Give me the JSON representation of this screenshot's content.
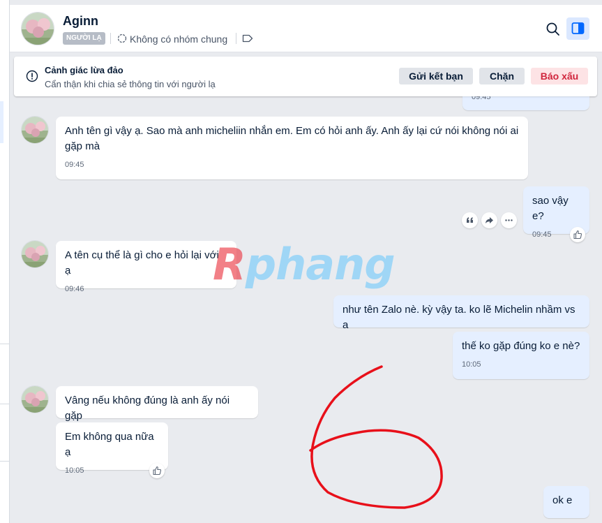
{
  "header": {
    "contact_name": "Aginn",
    "stranger_badge": "NGƯỜI LẠ",
    "common_groups": "Không có nhóm chung"
  },
  "alert": {
    "title": "Cảnh giác lừa đảo",
    "subtitle": "Cẩn thận khi chia sẻ thông tin với người lạ",
    "add_friend": "Gửi kết bạn",
    "block": "Chặn",
    "report": "Báo xấu"
  },
  "messages": [
    {
      "from": "them",
      "text": "Anh tên gì vậy ạ. Sao mà anh micheliin nhắn em. Em có hỏi anh ấy. Anh ấy lại cứ nói không nói ai gặp mà",
      "time": "09:45"
    },
    {
      "from": "me",
      "text": "sao vậy e?",
      "time": "09:45"
    },
    {
      "from": "them",
      "text": "A tên cụ thể là gì cho e hỏi lại với ạ",
      "time": "09:46"
    },
    {
      "from": "me",
      "text": "như tên Zalo nè. kỳ vậy ta. ko lẽ Michelin nhầm vs a",
      "time": ""
    },
    {
      "from": "me",
      "text": "thế ko gặp đúng ko e nè?",
      "time": "10:05"
    },
    {
      "from": "them",
      "text": "Vâng nếu không đúng là anh ấy nói gặp",
      "time": ""
    },
    {
      "from": "them",
      "text": "Em không qua nữa ạ",
      "time": "10:05"
    },
    {
      "from": "me",
      "text": "ok e",
      "time": ""
    }
  ],
  "partial_time": "09:45",
  "watermark": {
    "first": "R",
    "rest": "phang"
  },
  "colors": {
    "accent": "#0068ff",
    "report_text": "#d0253c",
    "outgoing_bubble": "#e5efff",
    "annotation": "#e8101a"
  }
}
